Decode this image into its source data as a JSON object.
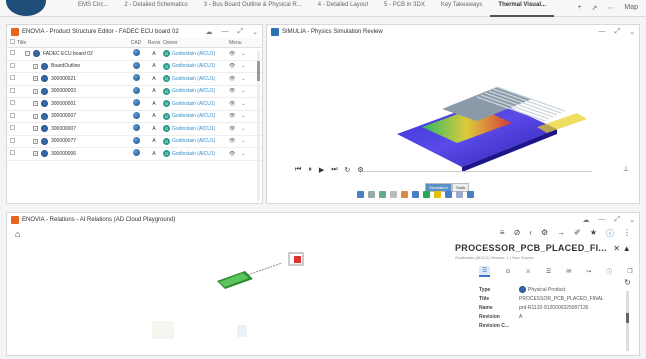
{
  "topbar": {
    "tabs": [
      "EMS Circ...",
      "2 - Detailed Schematics",
      "3 - Bus Board Outline & Physical R...",
      "4 - Detailed Layout",
      "5 - PCB in 3DX",
      "Key Takeaways",
      "Thermal Visual..."
    ],
    "active_tab": 6,
    "tools": [
      "+",
      "↗",
      "⋯",
      "Map"
    ]
  },
  "product_structure": {
    "title": "ENOVIA - Product Structure Editor - FADEC ECU board 02",
    "color": "#e8641c",
    "columns": {
      "title": "Title",
      "cad": "CAD",
      "revision": "Revis",
      "owner": "Owner",
      "menu": "Menu"
    },
    "rows": [
      {
        "title": "FADEC ECU board 02",
        "rev": "A",
        "owner": "Godinstain (AICU1)",
        "expand": "−"
      },
      {
        "title": "BoardOutline",
        "rev": "A",
        "owner": "Godinstain (AICU1)",
        "expand": "+"
      },
      {
        "title": "300000021",
        "rev": "A",
        "owner": "Godinstain (AICU1)",
        "expand": "+"
      },
      {
        "title": "300000003",
        "rev": "A",
        "owner": "Godinstain (AICU1)",
        "expand": "+"
      },
      {
        "title": "300000001",
        "rev": "A",
        "owner": "Godinstain (AICU1)",
        "expand": "+"
      },
      {
        "title": "300000007",
        "rev": "A",
        "owner": "Godinstain (AICU1)",
        "expand": "+"
      },
      {
        "title": "300000007",
        "rev": "A",
        "owner": "Godinstain (AICU1)",
        "expand": "+"
      },
      {
        "title": "300000077",
        "rev": "A",
        "owner": "Godinstain (AICU1)",
        "expand": "+"
      },
      {
        "title": "300000006",
        "rev": "A",
        "owner": "Godinstain (AICU1)",
        "expand": "+"
      }
    ]
  },
  "simulia": {
    "title": "SIMULIA - Physics Simulation Review",
    "color": "#2f6db5",
    "player": [
      "⏮",
      "⏸",
      "▶",
      "⏭",
      "↻",
      "⚙"
    ],
    "toolbar_tabs": [
      "Simulation",
      "Tools"
    ]
  },
  "relations": {
    "title": "ENOVIA - Relations - AI Relations (AD Cloud Playground)",
    "color": "#e8641c",
    "tools": [
      "≡",
      "⊘",
      "‹",
      "⚙",
      "→",
      "✐",
      "★",
      "ⓘ",
      "⋮"
    ],
    "info": {
      "title": "PROCESSOR_PCB_PLACED_FI...",
      "subtitle": "Godinstain (AICU1) Version: 1 | Your Source",
      "tabs": [
        "☰",
        "⊙",
        "⚔",
        "☰",
        "✉",
        "↪",
        "ⓘ",
        "❐"
      ],
      "properties": [
        {
          "key": "Type",
          "value": "Physical Product"
        },
        {
          "key": "Title",
          "value": "PROCESSOR_PCB_PLACED_FINAL"
        },
        {
          "key": "Name",
          "value": "prd-R1132-9120000325007135"
        },
        {
          "key": "Revision",
          "value": "A"
        },
        {
          "key": "Revision C...",
          "value": ""
        }
      ]
    }
  }
}
